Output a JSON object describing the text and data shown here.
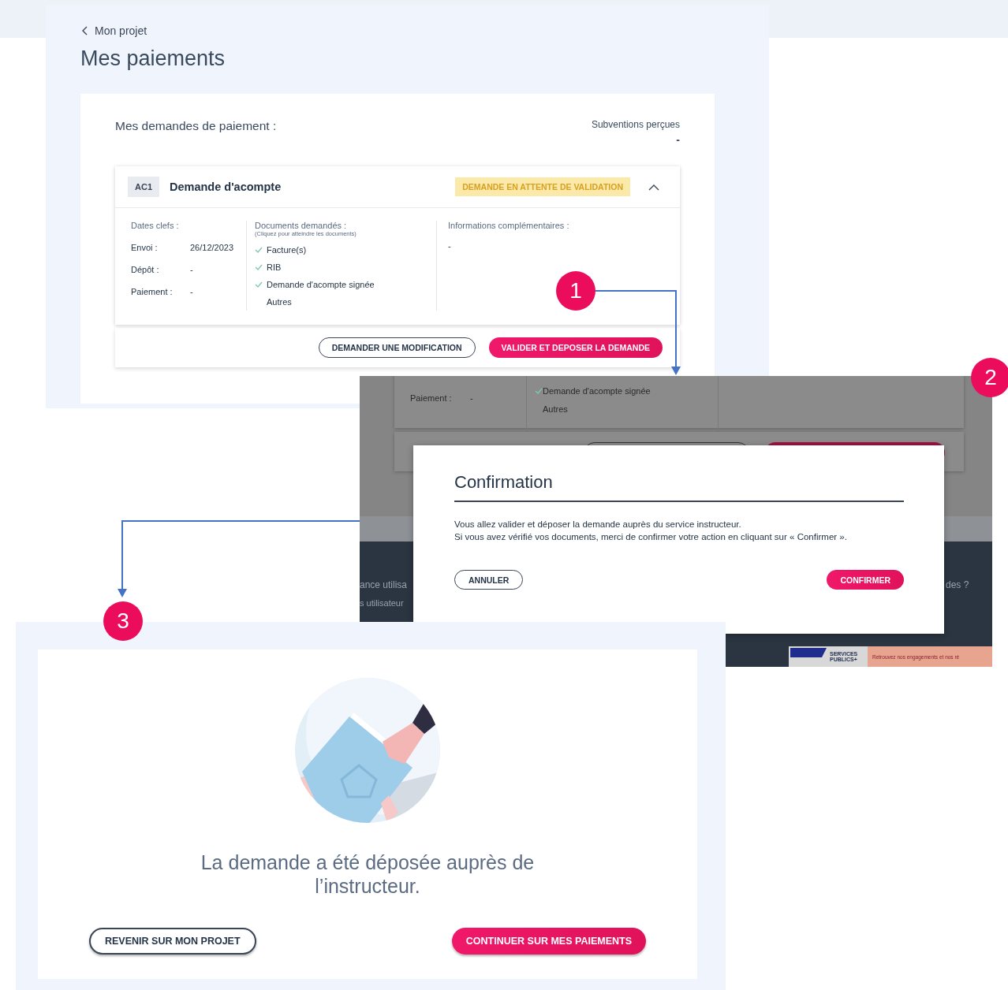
{
  "step_badges": [
    "1",
    "2",
    "3"
  ],
  "payments_page": {
    "back_link": "Mon projet",
    "title": "Mes paiements",
    "section_title": "Mes demandes de paiement :",
    "subsidies": {
      "label": "Subventions perçues",
      "value": "-"
    },
    "request": {
      "code": "AC1",
      "title": "Demande d'acompte",
      "status": "DEMANDE EN ATTENTE DE VALIDATION",
      "expanded": true,
      "dates": {
        "heading": "Dates clefs :",
        "rows": [
          {
            "label": "Envoi :",
            "value": "26/12/2023"
          },
          {
            "label": "Dépôt :",
            "value": "-"
          },
          {
            "label": "Paiement :",
            "value": "-"
          }
        ]
      },
      "documents": {
        "heading": "Documents demandés :",
        "hint": "(Cliquez pour atteindre les documents)",
        "items": [
          {
            "label": "Facture(s)",
            "checked": true
          },
          {
            "label": "RIB",
            "checked": true
          },
          {
            "label": "Demande d'acompte signée",
            "checked": true
          },
          {
            "label": "Autres",
            "checked": false
          }
        ]
      },
      "info": {
        "heading": "Informations complémentaires :",
        "value": "-"
      }
    },
    "buttons": [
      {
        "label": "DEMANDER UNE MODIFICATION",
        "kind": "outline"
      },
      {
        "label": "VALIDER ET DEPOSER LA DEMANDE",
        "kind": "primary"
      }
    ]
  },
  "confirmation_screen": {
    "background": {
      "row": {
        "label": "Paiement :",
        "value": "-"
      },
      "documents": [
        {
          "label": "Demande d'acompte signée",
          "checked": true
        },
        {
          "label": "Autres",
          "checked": false
        }
      ],
      "footer_texts": [
        "ance utilisa",
        "s utilisateur",
        "des ?"
      ],
      "banner": {
        "logo": "SERVICES PUBLICS+",
        "text": "Retrouvez nos engagements et nos ré"
      }
    },
    "dialog": {
      "title": "Confirmation",
      "paragraphs": [
        "Vous allez valider et déposer la demande auprès du service instructeur.",
        "Si vous avez vérifié vos documents, merci de confirmer votre action en cliquant sur « Confirmer »."
      ],
      "buttons": [
        {
          "label": "ANNULER",
          "kind": "outline"
        },
        {
          "label": "CONFIRMER",
          "kind": "primary"
        }
      ]
    }
  },
  "success_screen": {
    "message": "La demande a été déposée auprès de l’instructeur.",
    "buttons": [
      {
        "label": "REVENIR SUR MON PROJET",
        "kind": "outline"
      },
      {
        "label": "CONTINUER SUR MES PAIEMENTS",
        "kind": "primary"
      }
    ]
  }
}
